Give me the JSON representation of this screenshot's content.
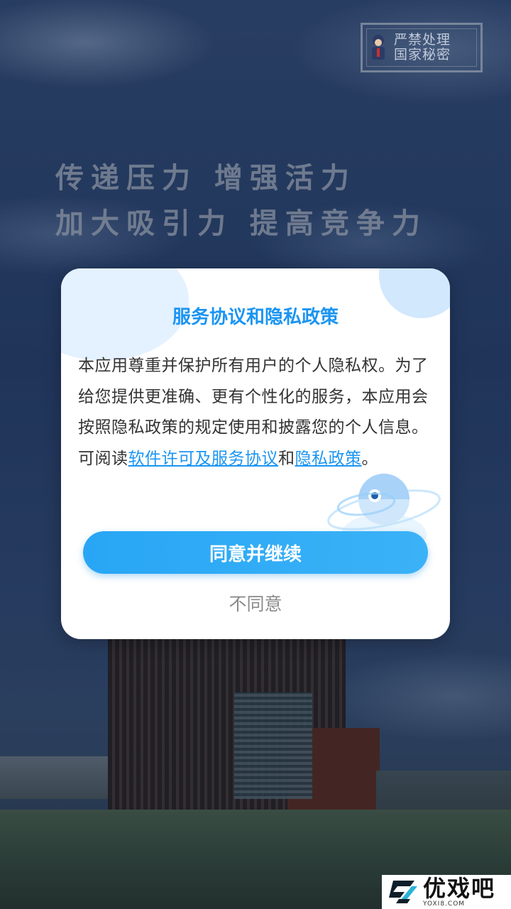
{
  "background": {
    "badge_lines": [
      "严禁处理",
      "国家秘密"
    ],
    "slogans": [
      "传递压力 增强活力",
      "加大吸引力 提高竞争力"
    ]
  },
  "dialog": {
    "title": "服务协议和隐私政策",
    "body_text": "本应用尊重并保护所有用户的个人隐私权。为了给您提供更准确、更有个性化的服务，本应用会按照隐私政策的规定使用和披露您的个人信息。可阅读",
    "link_terms": "软件许可及服务协议",
    "connector": "和",
    "link_privacy": "隐私政策",
    "end_punct": "。",
    "agree_label": "同意并继续",
    "disagree_label": "不同意"
  },
  "watermark": {
    "name": "优戏吧",
    "url": "YOXI8.COM"
  },
  "colors": {
    "accent": "#1b95f2",
    "button": "#2aa7f5",
    "body_text": "#333333",
    "secondary_text": "#8a8a8a"
  },
  "icons": [
    "security-guard-icon",
    "robot-illustration",
    "yoxi8-logo-icon"
  ]
}
